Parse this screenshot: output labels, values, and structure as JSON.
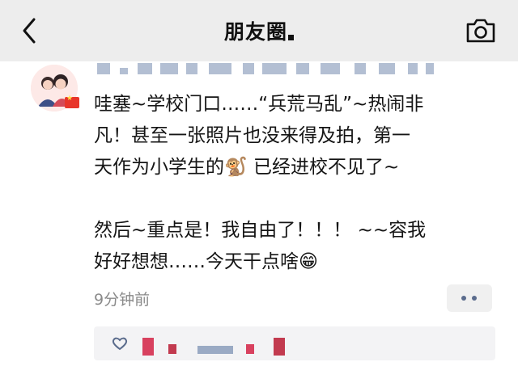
{
  "navbar": {
    "title": "朋友圈",
    "back_icon": "chevron-left-icon",
    "camera_icon": "camera-icon"
  },
  "post": {
    "text": "哇塞~学校门口……“兵荒马乱”~热闹非\n凡！甚至一张照片也没来得及拍，第一\n天作为小学生的🐒 已经进校不见了~\n\n然后~重点是！我自由了！！！ ~~容我\n好好想想……今天干点啥😁",
    "time": "9分钟前",
    "more_icon": "more-dots-icon",
    "like_icon": "heart-outline-icon"
  },
  "colors": {
    "navbar_bg": "#ededed",
    "link_blue": "#5a6b8c",
    "blur_red": "#d8415f"
  }
}
